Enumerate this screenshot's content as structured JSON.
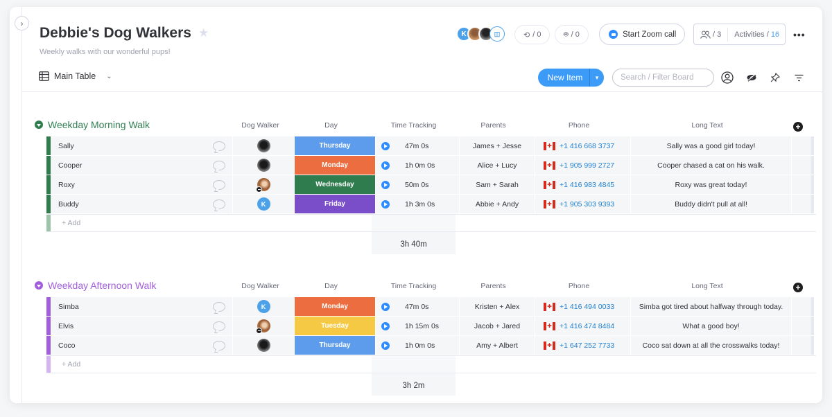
{
  "board": {
    "title": "Debbie's Dog Walkers",
    "description": "Weekly walks with our wonderful pups!",
    "view_label": "Main Table"
  },
  "header": {
    "subscribers": [
      {
        "type": "initial",
        "initial": "K"
      },
      {
        "type": "photo"
      },
      {
        "type": "photo"
      },
      {
        "type": "guest-icon"
      }
    ],
    "integrations_count": "/ 0",
    "automations_count": "/ 0",
    "zoom_label": "Start Zoom call",
    "members_count": "/ 3",
    "activities_label": "Activities /",
    "activities_count": "16",
    "more_label": "•••"
  },
  "toolbar": {
    "new_item_label": "New Item",
    "search_placeholder": "Search / Filter Board"
  },
  "columns": [
    "Dog Walker",
    "Day",
    "Time Tracking",
    "Parents",
    "Phone",
    "Long Text"
  ],
  "colors": {
    "morning_group": "#2f7d4f",
    "afternoon_group": "#a25ddc",
    "day_monday": "#ec6d3f",
    "day_tuesday": "#f6c944",
    "day_wednesday": "#2f7d4f",
    "day_thursday": "#5d9cec",
    "day_friday": "#7a4ec8",
    "accent": "#3d9bf8",
    "phone_link": "#1e7fcf"
  },
  "groups": [
    {
      "name": "Weekday Morning Walk",
      "add_label": "+ Add",
      "time_total": "3h 40m",
      "rows": [
        {
          "name": "Sally",
          "walker": "photo-dark",
          "day": "Thursday",
          "time": "47m 0s",
          "parents": "James + Jesse",
          "phone": "+1 416 668 3737",
          "long_text": "Sally was a good girl today!"
        },
        {
          "name": "Cooper",
          "walker": "photo-dark",
          "day": "Monday",
          "time": "1h 0m 0s",
          "parents": "Alice + Lucy",
          "phone": "+1 905 999 2727",
          "long_text": "Cooper chased a cat on his walk."
        },
        {
          "name": "Roxy",
          "walker": "photo-curly",
          "day": "Wednesday",
          "time": "50m 0s",
          "parents": "Sam + Sarah",
          "phone": "+1 416 983 4845",
          "long_text": "Roxy was great today!"
        },
        {
          "name": "Buddy",
          "walker": "K",
          "day": "Friday",
          "time": "1h 3m 0s",
          "parents": "Abbie + Andy",
          "phone": "+1 905 303 9393",
          "long_text": "Buddy didn't pull at all!"
        }
      ]
    },
    {
      "name": "Weekday Afternoon Walk",
      "add_label": "+ Add",
      "time_total": "3h 2m",
      "rows": [
        {
          "name": "Simba",
          "walker": "K",
          "day": "Monday",
          "time": "47m 0s",
          "parents": "Kristen + Alex",
          "phone": "+1 416 494 0033",
          "long_text": "Simba got tired about halfway through today."
        },
        {
          "name": "Elvis",
          "walker": "photo-curly",
          "day": "Tuesday",
          "time": "1h 15m 0s",
          "parents": "Jacob + Jared",
          "phone": "+1 416 474 8484",
          "long_text": "What a good boy!"
        },
        {
          "name": "Coco",
          "walker": "photo-dark",
          "day": "Thursday",
          "time": "1h 0m 0s",
          "parents": "Amy + Albert",
          "phone": "+1 647 252 7733",
          "long_text": "Coco sat down at all the crosswalks today!"
        }
      ]
    }
  ]
}
